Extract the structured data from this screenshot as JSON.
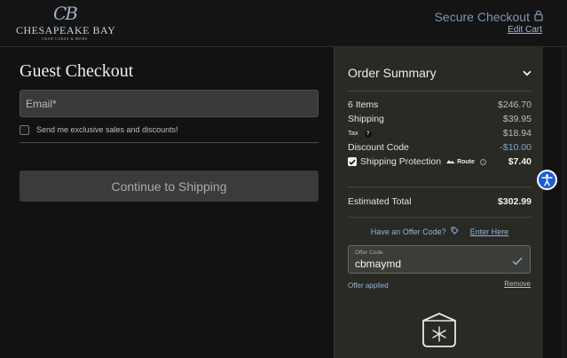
{
  "header": {
    "logo": {
      "monogram": "CB",
      "name": "CHESAPEAKE BAY",
      "tagline": "CRAB CAKES & MORE"
    },
    "secure_label": "Secure Checkout",
    "edit_cart_label": "Edit Cart"
  },
  "guest": {
    "title": "Guest Checkout",
    "email_placeholder": "Email*",
    "optin_label": "Send me exclusive sales and discounts!",
    "continue_label": "Continue to Shipping"
  },
  "summary": {
    "title": "Order Summary",
    "rows": {
      "items": {
        "label": "6 Items",
        "value": "$246.70"
      },
      "shipping": {
        "label": "Shipping",
        "value": "$39.95"
      },
      "tax": {
        "label": "Tax",
        "badge": "?",
        "value": "$18.94"
      },
      "discount": {
        "label": "Discount Code",
        "value": "-$10.00"
      },
      "protection": {
        "label": "Shipping Protection",
        "route": "Route",
        "info": "i",
        "value": "$7.40",
        "checked": true
      }
    },
    "total": {
      "label": "Estimated Total",
      "value": "$302.99"
    },
    "offer": {
      "question": "Have an Offer Code?",
      "enter_label": "Enter Here",
      "field_label": "Offer Code",
      "field_value": "cbmaymd",
      "applied_label": "Offer applied",
      "remove_label": "Remove"
    }
  },
  "colors": {
    "accent_link": "#8fb3dc",
    "summary_bg": "#292a24",
    "a11y_button": "#1f5bd8"
  },
  "icons": [
    "lock-icon",
    "chevron-down-icon",
    "tag-icon",
    "check-icon",
    "snowflake-box-icon",
    "accessibility-icon"
  ]
}
